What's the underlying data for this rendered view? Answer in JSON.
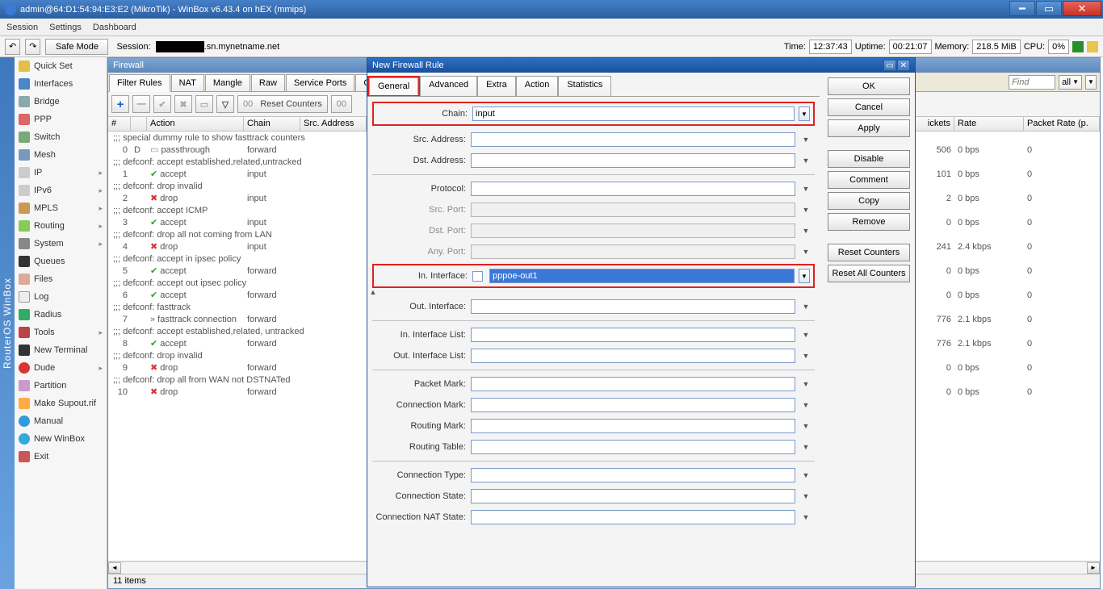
{
  "window": {
    "title": "admin@64:D1:54:94:E3:E2 (MikroTik) - WinBox v6.43.4 on hEX (mmips)"
  },
  "menubar": [
    "Session",
    "Settings",
    "Dashboard"
  ],
  "infobar": {
    "safe_mode": "Safe Mode",
    "session_label": "Session:",
    "session_tail": ".sn.mynetname.net",
    "time_label": "Time:",
    "time_val": "12:37:43",
    "uptime_label": "Uptime:",
    "uptime_val": "00:21:07",
    "memory_label": "Memory:",
    "memory_val": "218.5 MiB",
    "cpu_label": "CPU:",
    "cpu_val": "0%"
  },
  "ros_strip": "RouterOS WinBox",
  "sidebar": [
    {
      "label": "Quick Set",
      "cls": "ic-quick"
    },
    {
      "label": "Interfaces",
      "cls": "ic-int"
    },
    {
      "label": "Bridge",
      "cls": "ic-br"
    },
    {
      "label": "PPP",
      "cls": "ic-ppp"
    },
    {
      "label": "Switch",
      "cls": "ic-sw"
    },
    {
      "label": "Mesh",
      "cls": "ic-mesh"
    },
    {
      "label": "IP",
      "cls": "ic-ip",
      "sub": true
    },
    {
      "label": "IPv6",
      "cls": "ic-ipv6",
      "sub": true
    },
    {
      "label": "MPLS",
      "cls": "ic-mpls",
      "sub": true
    },
    {
      "label": "Routing",
      "cls": "ic-route",
      "sub": true
    },
    {
      "label": "System",
      "cls": "ic-sys",
      "sub": true
    },
    {
      "label": "Queues",
      "cls": "ic-q"
    },
    {
      "label": "Files",
      "cls": "ic-files"
    },
    {
      "label": "Log",
      "cls": "ic-log"
    },
    {
      "label": "Radius",
      "cls": "ic-rad"
    },
    {
      "label": "Tools",
      "cls": "ic-tools",
      "sub": true
    },
    {
      "label": "New Terminal",
      "cls": "ic-term"
    },
    {
      "label": "Dude",
      "cls": "ic-dude",
      "sub": true
    },
    {
      "label": "Partition",
      "cls": "ic-part"
    },
    {
      "label": "Make Supout.rif",
      "cls": "ic-sup"
    },
    {
      "label": "Manual",
      "cls": "ic-man"
    },
    {
      "label": "New WinBox",
      "cls": "ic-wb"
    },
    {
      "label": "Exit",
      "cls": "ic-exit"
    }
  ],
  "firewall": {
    "title": "Firewall",
    "tabs": [
      "Filter Rules",
      "NAT",
      "Mangle",
      "Raw",
      "Service Ports",
      "Connections"
    ],
    "find_placeholder": "Find",
    "all_label": "all",
    "toolbar": {
      "reset_counters": "Reset Counters",
      "reset_all": "00"
    },
    "columns_left": [
      "#",
      "",
      "Action",
      "Chain",
      "Src. Address"
    ],
    "columns_right": [
      "ickets",
      "Rate",
      "Packet Rate (p."
    ],
    "rows": [
      {
        "comment": ";;; special dummy rule to show fasttrack counters"
      },
      {
        "n": "0",
        "flag": "D",
        "icon": "pass",
        "action": "passthrough",
        "chain": "forward"
      },
      {
        "comment": ";;; defconf: accept established,related,untracked"
      },
      {
        "n": "1",
        "icon": "accept",
        "action": "accept",
        "chain": "input"
      },
      {
        "comment": ";;; defconf: drop invalid"
      },
      {
        "n": "2",
        "icon": "drop",
        "action": "drop",
        "chain": "input"
      },
      {
        "comment": ";;; defconf: accept ICMP"
      },
      {
        "n": "3",
        "icon": "accept",
        "action": "accept",
        "chain": "input"
      },
      {
        "comment": ";;; defconf: drop all not coming from LAN"
      },
      {
        "n": "4",
        "icon": "drop",
        "action": "drop",
        "chain": "input"
      },
      {
        "comment": ";;; defconf: accept in ipsec policy"
      },
      {
        "n": "5",
        "icon": "accept",
        "action": "accept",
        "chain": "forward"
      },
      {
        "comment": ";;; defconf: accept out ipsec policy"
      },
      {
        "n": "6",
        "icon": "accept",
        "action": "accept",
        "chain": "forward"
      },
      {
        "comment": ";;; defconf: fasttrack"
      },
      {
        "n": "7",
        "icon": "ft",
        "action": "fasttrack connection",
        "chain": "forward"
      },
      {
        "comment": ";;; defconf: accept established,related, untracked"
      },
      {
        "n": "8",
        "icon": "accept",
        "action": "accept",
        "chain": "forward"
      },
      {
        "comment": ";;; defconf: drop invalid"
      },
      {
        "n": "9",
        "icon": "drop",
        "action": "drop",
        "chain": "forward"
      },
      {
        "comment": ";;; defconf:  drop all from WAN not DSTNATed"
      },
      {
        "n": "10",
        "icon": "drop",
        "action": "drop",
        "chain": "forward"
      }
    ],
    "right_rows": [
      {
        "p": "506",
        "r": "0 bps",
        "pr": "0"
      },
      {
        "p": "101",
        "r": "0 bps",
        "pr": "0"
      },
      {
        "p": "2",
        "r": "0 bps",
        "pr": "0"
      },
      {
        "p": "0",
        "r": "0 bps",
        "pr": "0"
      },
      {
        "p": "241",
        "r": "2.4 kbps",
        "pr": "0"
      },
      {
        "p": "0",
        "r": "0 bps",
        "pr": "0"
      },
      {
        "p": "0",
        "r": "0 bps",
        "pr": "0"
      },
      {
        "p": "776",
        "r": "2.1 kbps",
        "pr": "0"
      },
      {
        "p": "776",
        "r": "2.1 kbps",
        "pr": "0"
      },
      {
        "p": "0",
        "r": "0 bps",
        "pr": "0"
      },
      {
        "p": "0",
        "r": "0 bps",
        "pr": "0"
      }
    ],
    "status": "11 items"
  },
  "dialog": {
    "title": "New Firewall Rule",
    "tabs": [
      "General",
      "Advanced",
      "Extra",
      "Action",
      "Statistics"
    ],
    "fields": {
      "chain": "Chain:",
      "chain_val": "input",
      "src_addr": "Src. Address:",
      "dst_addr": "Dst. Address:",
      "protocol": "Protocol:",
      "src_port": "Src. Port:",
      "dst_port": "Dst. Port:",
      "any_port": "Any. Port:",
      "in_iface": "In. Interface:",
      "in_iface_val": "pppoe-out1",
      "out_iface": "Out. Interface:",
      "in_list": "In. Interface List:",
      "out_list": "Out. Interface List:",
      "pkt_mark": "Packet Mark:",
      "conn_mark": "Connection Mark:",
      "routing_mark": "Routing Mark:",
      "routing_table": "Routing Table:",
      "conn_type": "Connection Type:",
      "conn_state": "Connection State:",
      "conn_nat": "Connection NAT State:"
    },
    "buttons": [
      "OK",
      "Cancel",
      "Apply",
      "Disable",
      "Comment",
      "Copy",
      "Remove",
      "Reset Counters",
      "Reset All Counters"
    ]
  }
}
